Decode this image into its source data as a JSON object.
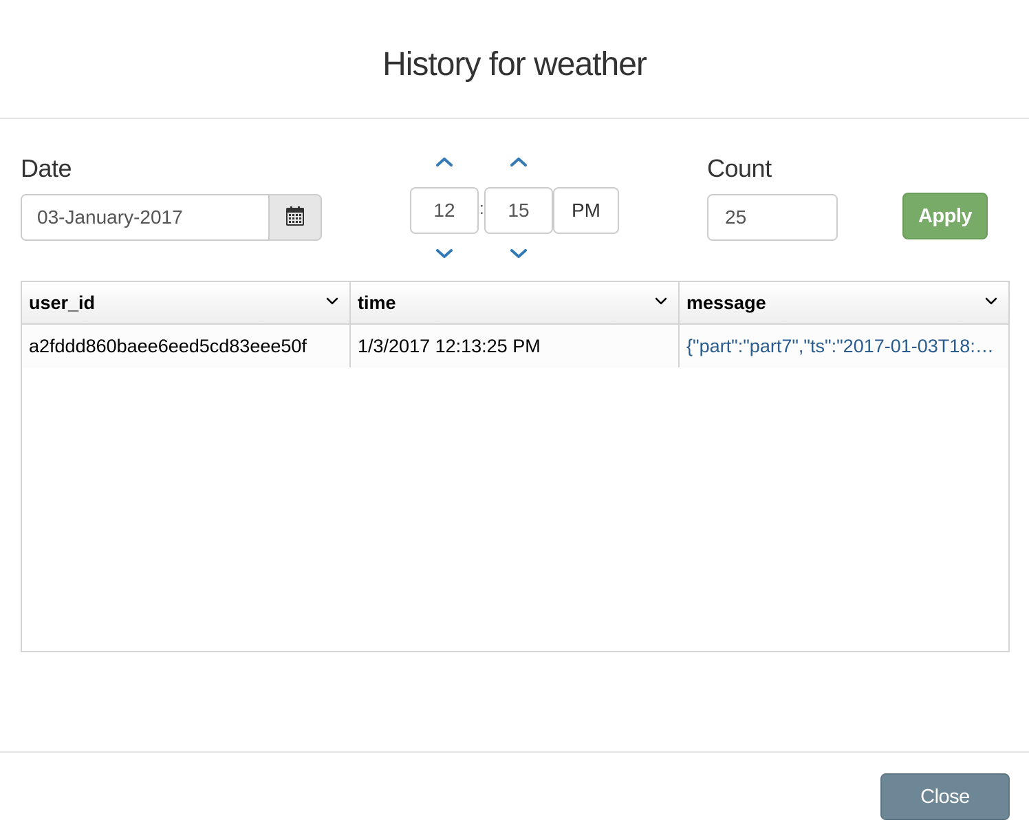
{
  "modal": {
    "title": "History for weather"
  },
  "filters": {
    "date_label": "Date",
    "date_value": "03-January-2017",
    "time": {
      "hour": "12",
      "minute": "15",
      "separator": ":",
      "meridian": "PM"
    },
    "count_label": "Count",
    "count_value": "25",
    "apply_label": "Apply"
  },
  "grid": {
    "columns": [
      "user_id",
      "time",
      "message"
    ],
    "rows": [
      {
        "user_id": "a2fddd860baee6eed5cd83eee50f",
        "time": "1/3/2017 12:13:25 PM",
        "message": "{\"part\":\"part7\",\"ts\":\"2017-01-03T18:…"
      }
    ]
  },
  "footer": {
    "close_label": "Close"
  },
  "colors": {
    "apply_bg": "#78aa68",
    "close_bg": "#6e8797",
    "arrow": "#337ab7",
    "link": "#2a5d8f"
  },
  "icons": {
    "date_button": "calendar-icon",
    "time_increment": "chevron-up-icon",
    "time_decrement": "chevron-down-icon",
    "column_menu": "chevron-down-icon"
  }
}
